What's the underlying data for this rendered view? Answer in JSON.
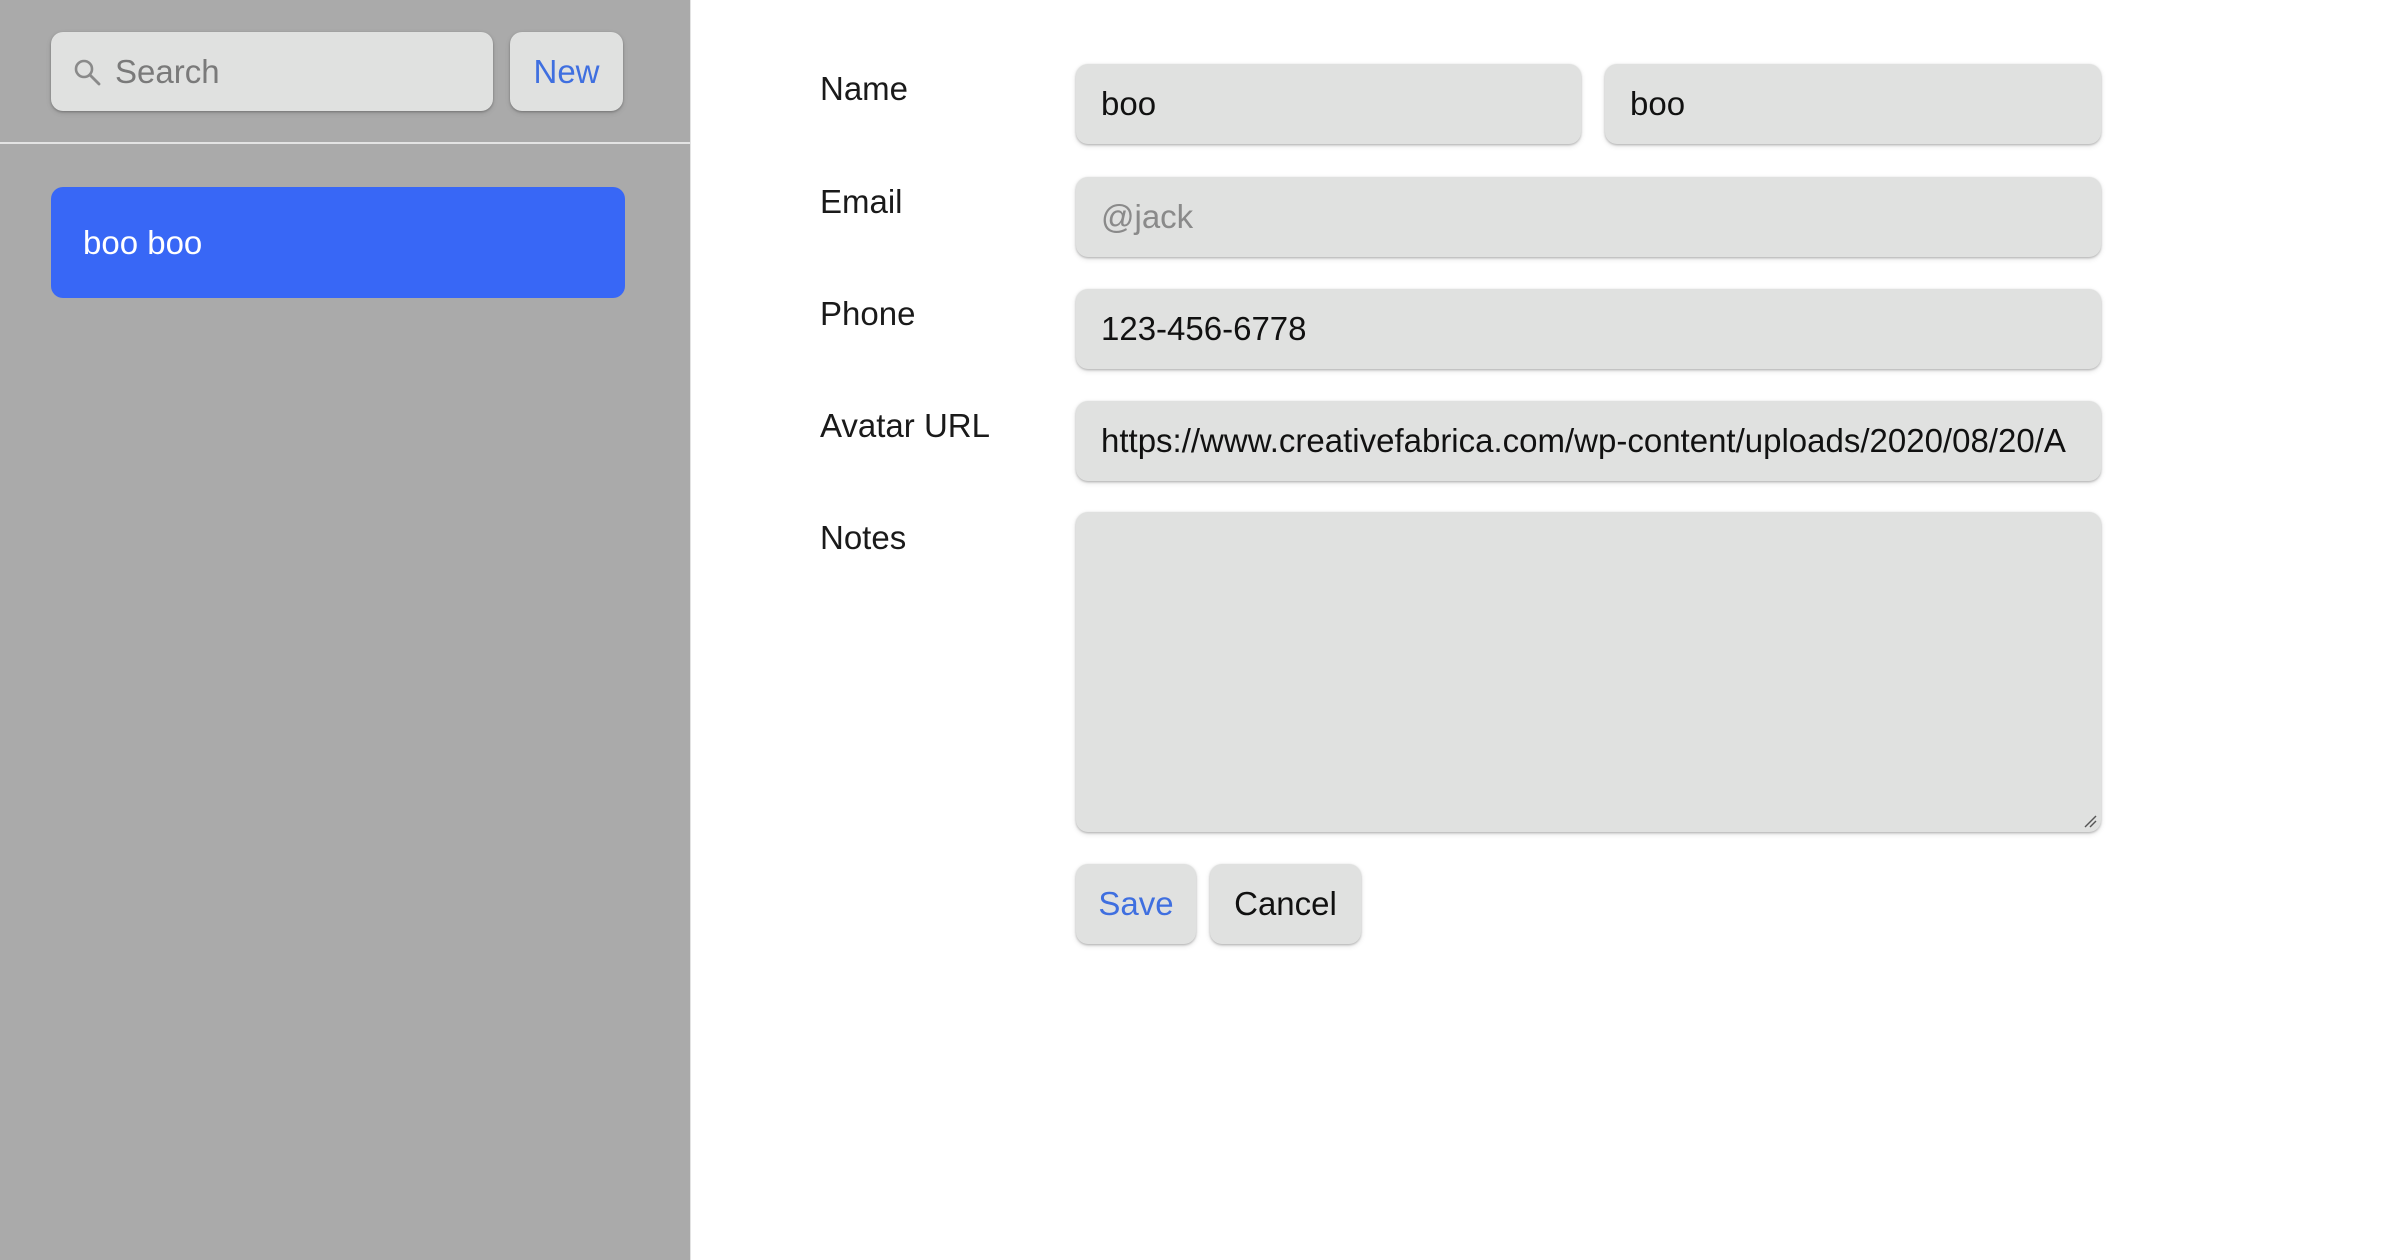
{
  "sidebar": {
    "search": {
      "placeholder": "Search",
      "value": "",
      "icon": "search-icon"
    },
    "new_button_label": "New",
    "contacts": [
      {
        "label": "boo boo",
        "selected": true
      }
    ],
    "selected_color": "#3867f6"
  },
  "form": {
    "name": {
      "label": "Name",
      "first": "boo",
      "last": "boo"
    },
    "email": {
      "label": "Email",
      "placeholder": "@jack",
      "value": ""
    },
    "phone": {
      "label": "Phone",
      "value": "123-456-6778"
    },
    "avatar": {
      "label": "Avatar URL",
      "value": "https://www.creativefabrica.com/wp-content/uploads/2020/08/20/A"
    },
    "notes": {
      "label": "Notes",
      "value": ""
    },
    "save_label": "Save",
    "cancel_label": "Cancel"
  },
  "colors": {
    "accent": "#3f6fe0",
    "sidebar_bg": "#aaaaaa",
    "field_bg": "#e0e1e0"
  }
}
